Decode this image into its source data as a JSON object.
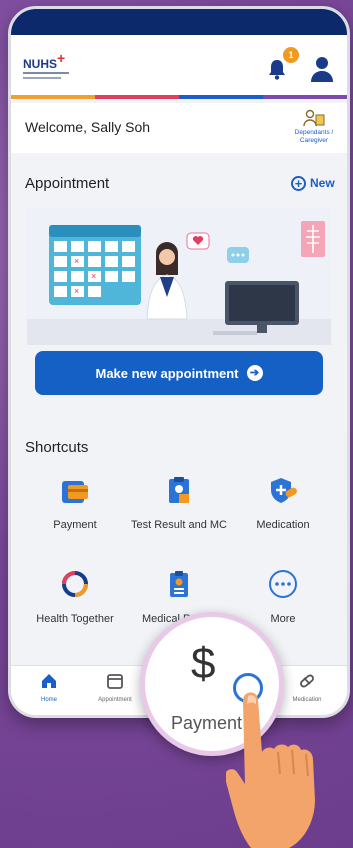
{
  "header": {
    "logo_text": "NUHS",
    "notification_count": "1"
  },
  "welcome": {
    "greeting": "Welcome, Sally Soh",
    "dependants_label": "Dependants / Caregiver"
  },
  "appointment": {
    "title": "Appointment",
    "new_label": "New",
    "make_button_label": "Make new appointment"
  },
  "shortcuts": {
    "title": "Shortcuts",
    "items": [
      {
        "label": "Payment",
        "icon": "card-icon"
      },
      {
        "label": "Test Result and MC",
        "icon": "clipboard-icon"
      },
      {
        "label": "Medication",
        "icon": "shield-pill-icon"
      },
      {
        "label": "Health Together",
        "icon": "heart-ring-icon"
      },
      {
        "label": "Medical Report",
        "icon": "report-icon"
      },
      {
        "label": "More",
        "icon": "more-icon"
      }
    ]
  },
  "tabbar": {
    "items": [
      {
        "label": "Home",
        "icon": "home-icon"
      },
      {
        "label": "Appointment",
        "icon": "calendar-icon"
      },
      {
        "label": "Payment",
        "icon": "dollar-icon"
      },
      {
        "label": "",
        "icon": "records-icon"
      },
      {
        "label": "Medication",
        "icon": "pill-icon"
      }
    ]
  },
  "magnifier": {
    "symbol": "$",
    "label": "Payment"
  },
  "colors": {
    "primary": "#1560c4",
    "navy": "#0c2a6b",
    "background": "#7d4a9c",
    "badge": "#f29a1f"
  }
}
